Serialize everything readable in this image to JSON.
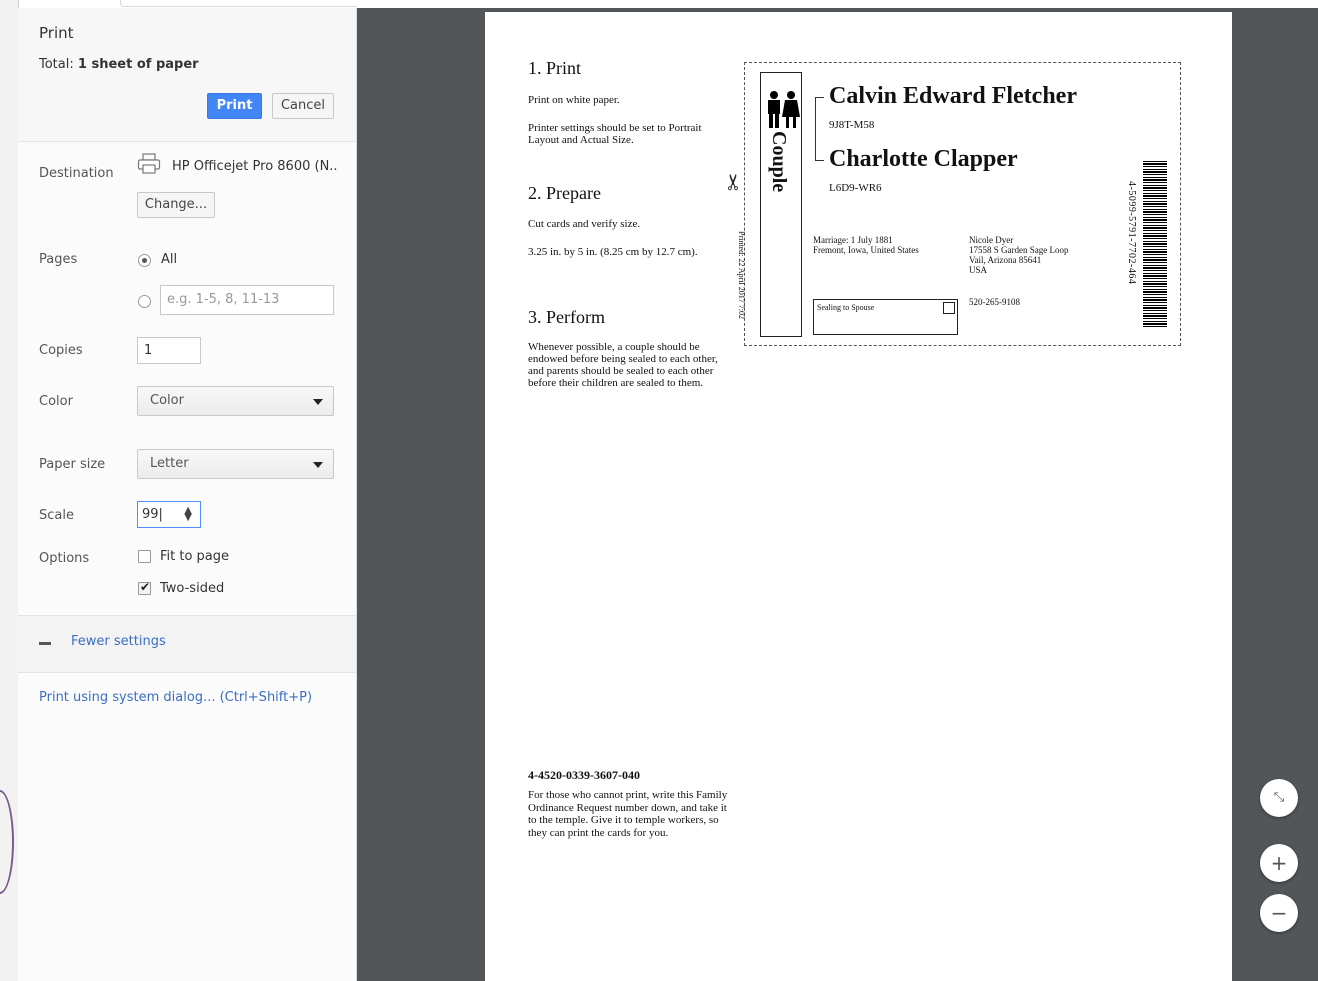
{
  "dialog": {
    "title": "Print",
    "total_label": "Total:",
    "total_value": "1 sheet of paper",
    "print_label": "Print",
    "cancel_label": "Cancel"
  },
  "destination": {
    "label": "Destination",
    "printer": "HP Officejet Pro 8600 (N..",
    "change_label": "Change..."
  },
  "pages": {
    "label": "Pages",
    "all_label": "All",
    "custom_placeholder": "e.g. 1-5, 8, 11-13"
  },
  "copies": {
    "label": "Copies",
    "value": "1"
  },
  "color": {
    "label": "Color",
    "value": "Color"
  },
  "paper_size": {
    "label": "Paper size",
    "value": "Letter"
  },
  "scale": {
    "label": "Scale",
    "value": "99"
  },
  "options": {
    "label": "Options",
    "fit_to_page": "Fit to page",
    "two_sided": "Two-sided"
  },
  "fewer_settings": "Fewer settings",
  "system_dialog": "Print using system dialog... (Ctrl+Shift+P)",
  "preview": {
    "step1_title": "1. Print",
    "step1_p1": "Print on white paper.",
    "step1_p2": "Printer settings should be set to Portrait Layout and Actual Size.",
    "step2_title": "2. Prepare",
    "step2_p1": "Cut cards and verify size.",
    "step2_p2": "3.25 in. by 5 in. (8.25 cm by 12.7 cm).",
    "step3_title": "3. Perform",
    "step3_p1": "Whenever possible, a couple should be endowed before being sealed to each other, and parents should be sealed to each other before their children are sealed to them.",
    "card": {
      "side_word": "Couple",
      "printed": "Printed: 22 April 2017 7:02",
      "name1": "Calvin Edward Fletcher",
      "id1": "9J8T-M58",
      "name2": "Charlotte Clapper",
      "id2": "L6D9-WR6",
      "marriage_line1": "Marriage: 1 July 1881",
      "marriage_line2": "Fremont, Iowa, United States",
      "addr1": "Nicole Dyer",
      "addr2": "17558 S Garden Sage Loop",
      "addr3": "Vail, Arizona 85641",
      "addr4": "USA",
      "phone": "520-265-9108",
      "seal_label": "Sealing to Spouse",
      "barcode_number": "4-5099-5791-7702-464"
    },
    "request_number": "4-4520-0339-3607-040",
    "request_text": "For those who cannot print, write this Family Ordinance Request number down, and take it to the temple. Give it to temple workers, so they can print the cards for you."
  },
  "zoom": {
    "fit_icon": "fit-to-width",
    "plus": "+",
    "minus": "−"
  }
}
